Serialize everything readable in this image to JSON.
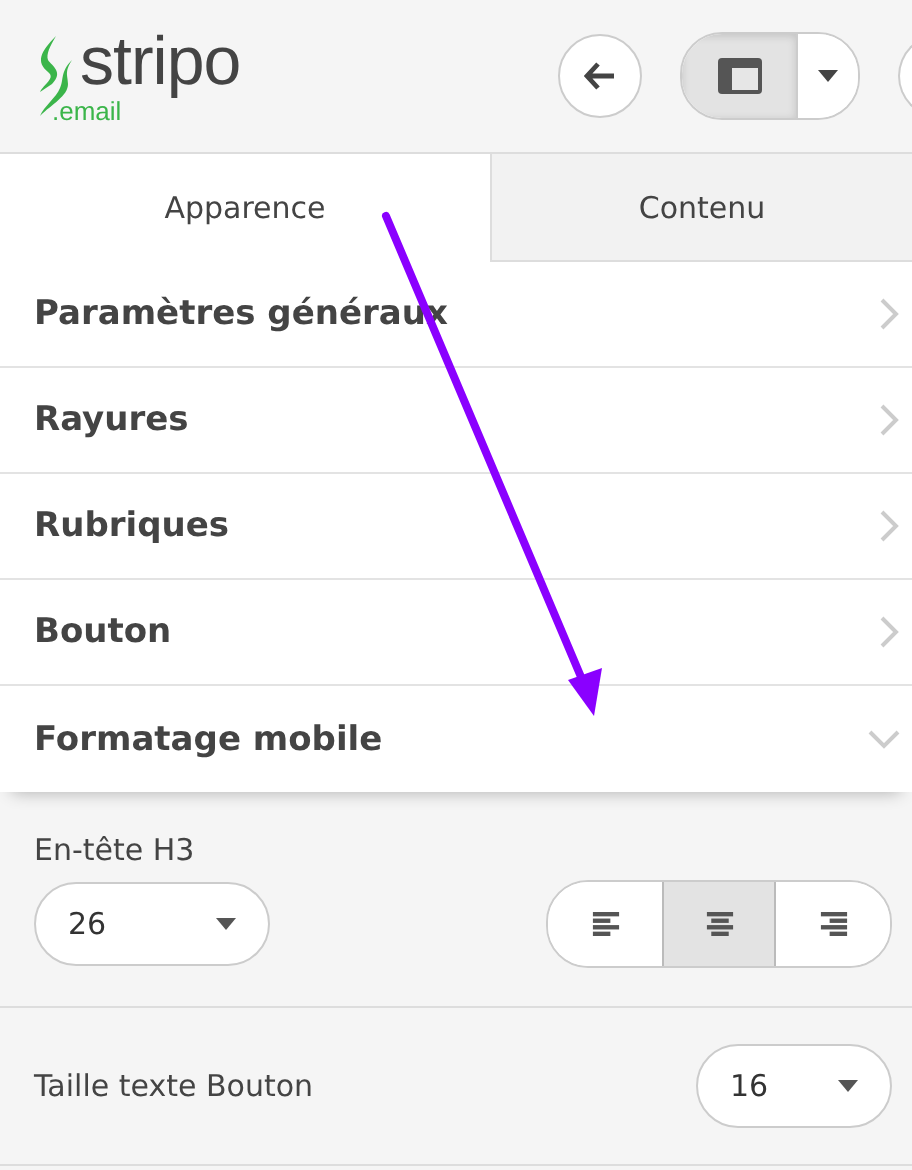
{
  "logo": {
    "name": "stripo",
    "suffix": ".email"
  },
  "header": {
    "view_toggle_pressed": true
  },
  "tabs": [
    {
      "label": "Apparence",
      "selected": true
    },
    {
      "label": "Contenu",
      "selected": false
    }
  ],
  "sections": [
    {
      "label": "Paramètres généraux",
      "expanded": false
    },
    {
      "label": "Rayures",
      "expanded": false
    },
    {
      "label": "Rubriques",
      "expanded": false
    },
    {
      "label": "Bouton",
      "expanded": false
    },
    {
      "label": "Formatage mobile",
      "expanded": true
    }
  ],
  "mobile_settings": {
    "heading_label": "En-tête H3",
    "heading_size": "26",
    "alignment": [
      {
        "kind": "left",
        "selected": false
      },
      {
        "kind": "center",
        "selected": true
      },
      {
        "kind": "right",
        "selected": false
      }
    ],
    "button_text_label": "Taille texte Bouton",
    "button_text_size": "16"
  }
}
